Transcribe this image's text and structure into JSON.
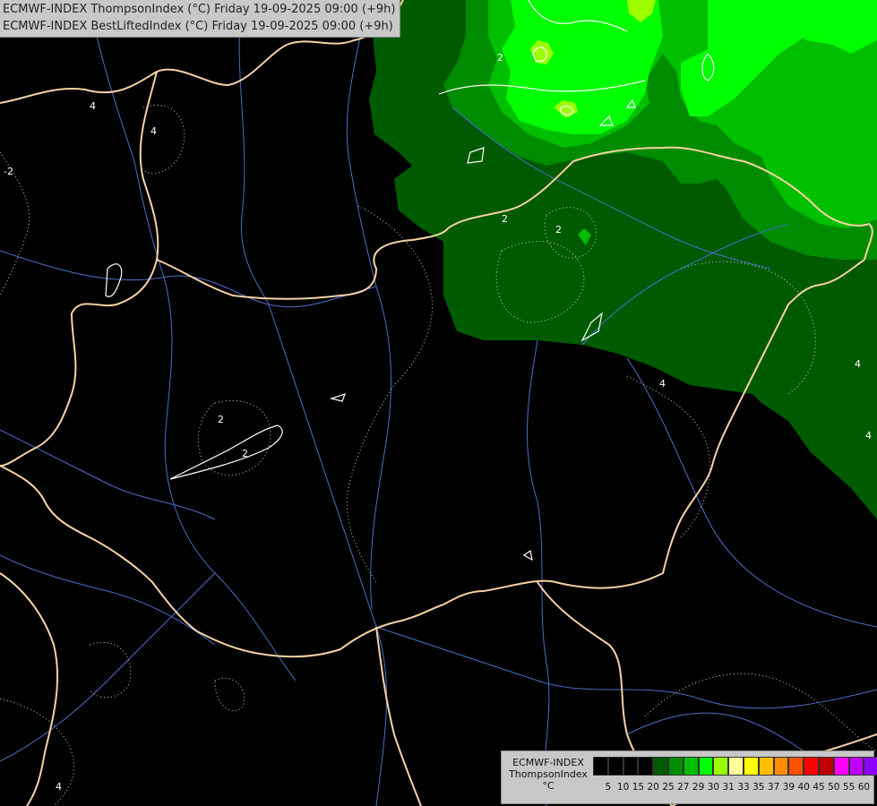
{
  "header": {
    "line1": "ECMWF-INDEX ThompsonIndex (°C) Friday 19-09-2025 09:00 (+9h)",
    "line2": "ECMWF-INDEX BestLiftedIndex (°C) Friday 19-09-2025 09:00 (+9h)"
  },
  "legend": {
    "title": [
      "ECMWF-INDEX",
      "ThompsonIndex",
      "°C"
    ],
    "colors": [
      "#000000",
      "#000000",
      "#000000",
      "#000000",
      "#005a00",
      "#008c00",
      "#00be00",
      "#00ff00",
      "#9bff00",
      "#ffff9b",
      "#ffff00",
      "#ffbe00",
      "#ff8c00",
      "#ff5000",
      "#ff0000",
      "#be0000",
      "#ff00ff",
      "#be00ff",
      "#8c00ff",
      "#5000ff",
      "#0000ff"
    ],
    "ticks": [
      "5",
      "10",
      "15",
      "20",
      "25",
      "27",
      "29",
      "30",
      "31",
      "33",
      "35",
      "37",
      "39",
      "40",
      "45",
      "50",
      "55",
      "60"
    ]
  },
  "contour_labels": [
    "2",
    "2",
    "2",
    "2",
    "2",
    "4",
    "4",
    "4",
    "4",
    "4",
    "4",
    "-2"
  ],
  "colors": {
    "background": "#000000",
    "border_line": "#f5d2a5",
    "river_line": "#4a6fc8",
    "contour_line": "#d0d0d0",
    "fill_dark": "#005a00",
    "fill_mid": "#008c00",
    "fill_light": "#00be00",
    "fill_bright": "#00ff00",
    "fill_yellowgreen": "#9bff00"
  }
}
